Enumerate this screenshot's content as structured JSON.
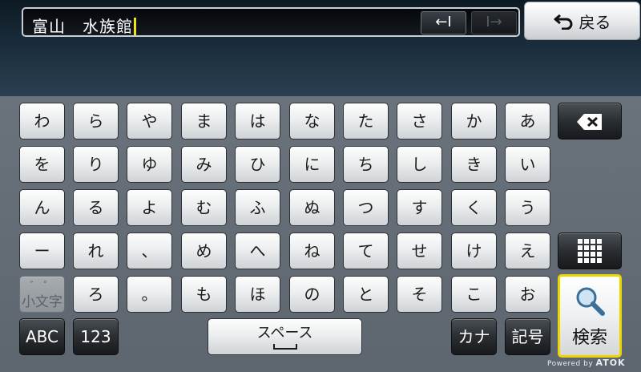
{
  "input": {
    "text": "富山　水族館",
    "cursor_left_label": "←I",
    "cursor_right_label": "I→"
  },
  "back_button": {
    "label": "戻る"
  },
  "keys": {
    "row1": [
      "わ",
      "ら",
      "や",
      "ま",
      "は",
      "な",
      "た",
      "さ",
      "か",
      "あ"
    ],
    "row2": [
      "を",
      "り",
      "ゆ",
      "み",
      "ひ",
      "に",
      "ち",
      "し",
      "き",
      "い"
    ],
    "row3": [
      "ん",
      "る",
      "よ",
      "む",
      "ふ",
      "ぬ",
      "つ",
      "す",
      "く",
      "う"
    ],
    "row4": [
      "ー",
      "れ",
      "、",
      "め",
      "へ",
      "ね",
      "て",
      "せ",
      "け",
      "え"
    ],
    "row5": [
      "ろ",
      "。",
      "も",
      "ほ",
      "の",
      "と",
      "そ",
      "こ",
      "お"
    ]
  },
  "small_char_key": {
    "sub": "゛ ゜",
    "label": "小文字"
  },
  "bottom": {
    "abc": "ABC",
    "num": "123",
    "space": "スペース",
    "kana": "カナ",
    "symbol": "記号",
    "search": "検索"
  },
  "footer": {
    "powered_by": "Powered by",
    "brand": "ATOK"
  }
}
